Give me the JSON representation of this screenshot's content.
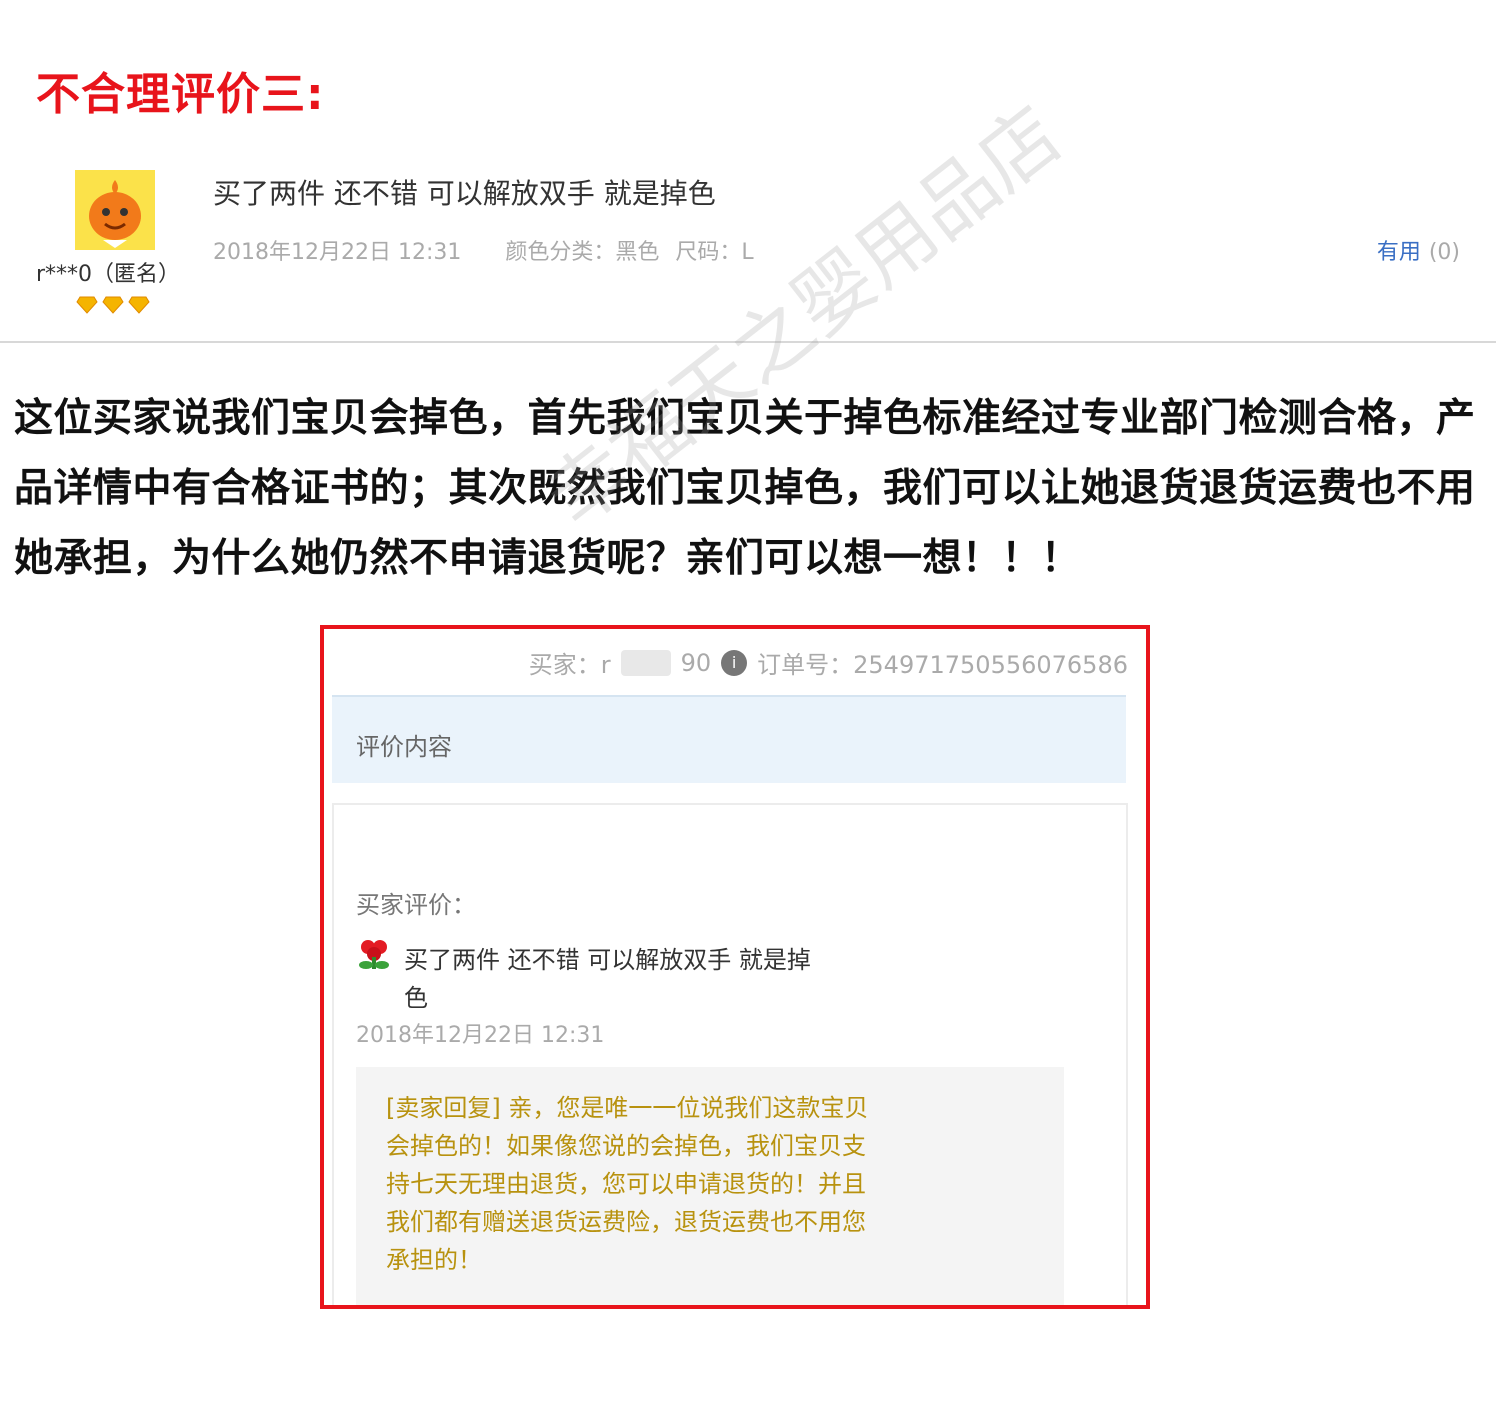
{
  "heading": "不合理评价三:",
  "review": {
    "username": "r***0（匿名）",
    "text": "买了两件 还不错 可以解放双手 就是掉色",
    "date": "2018年12月22日 12:31",
    "color": "颜色分类：黑色",
    "size": "尺码：L",
    "useful_label": "有用",
    "useful_count": "(0)"
  },
  "explanation": "这位买家说我们宝贝会掉色，首先我们宝贝关于掉色标准经过专业部门检测合格，产品详情中有合格证书的；其次既然我们宝贝掉色，我们可以让她退货退货运费也不用她承担，为什么她仍然不申请退货呢？亲们可以想一想！！！",
  "watermark": "幸福天之婴用品店",
  "screenshot": {
    "buyer_prefix": "买家：r",
    "buyer_suffix": "90",
    "order_label": "订单号：2549717505560765",
    "order_tail": "86",
    "panel_title": "评价内容",
    "buyer_eval_label": "买家评价：",
    "buyer_comment": "买了两件 还不错 可以解放双手 就是掉色",
    "buyer_date": "2018年12月22日 12:31",
    "seller_reply": "[卖家回复] 亲，您是唯一一位说我们这款宝贝会掉色的！如果像您说的会掉色，我们宝贝支持七天无理由退货，您可以申请退货的！并且我们都有赠送退货运费险，退货运费也不用您承担的！"
  },
  "colors": {
    "accent_red": "#e8141b",
    "link_blue": "#3a6fc4",
    "reply_gold": "#b8920f"
  }
}
